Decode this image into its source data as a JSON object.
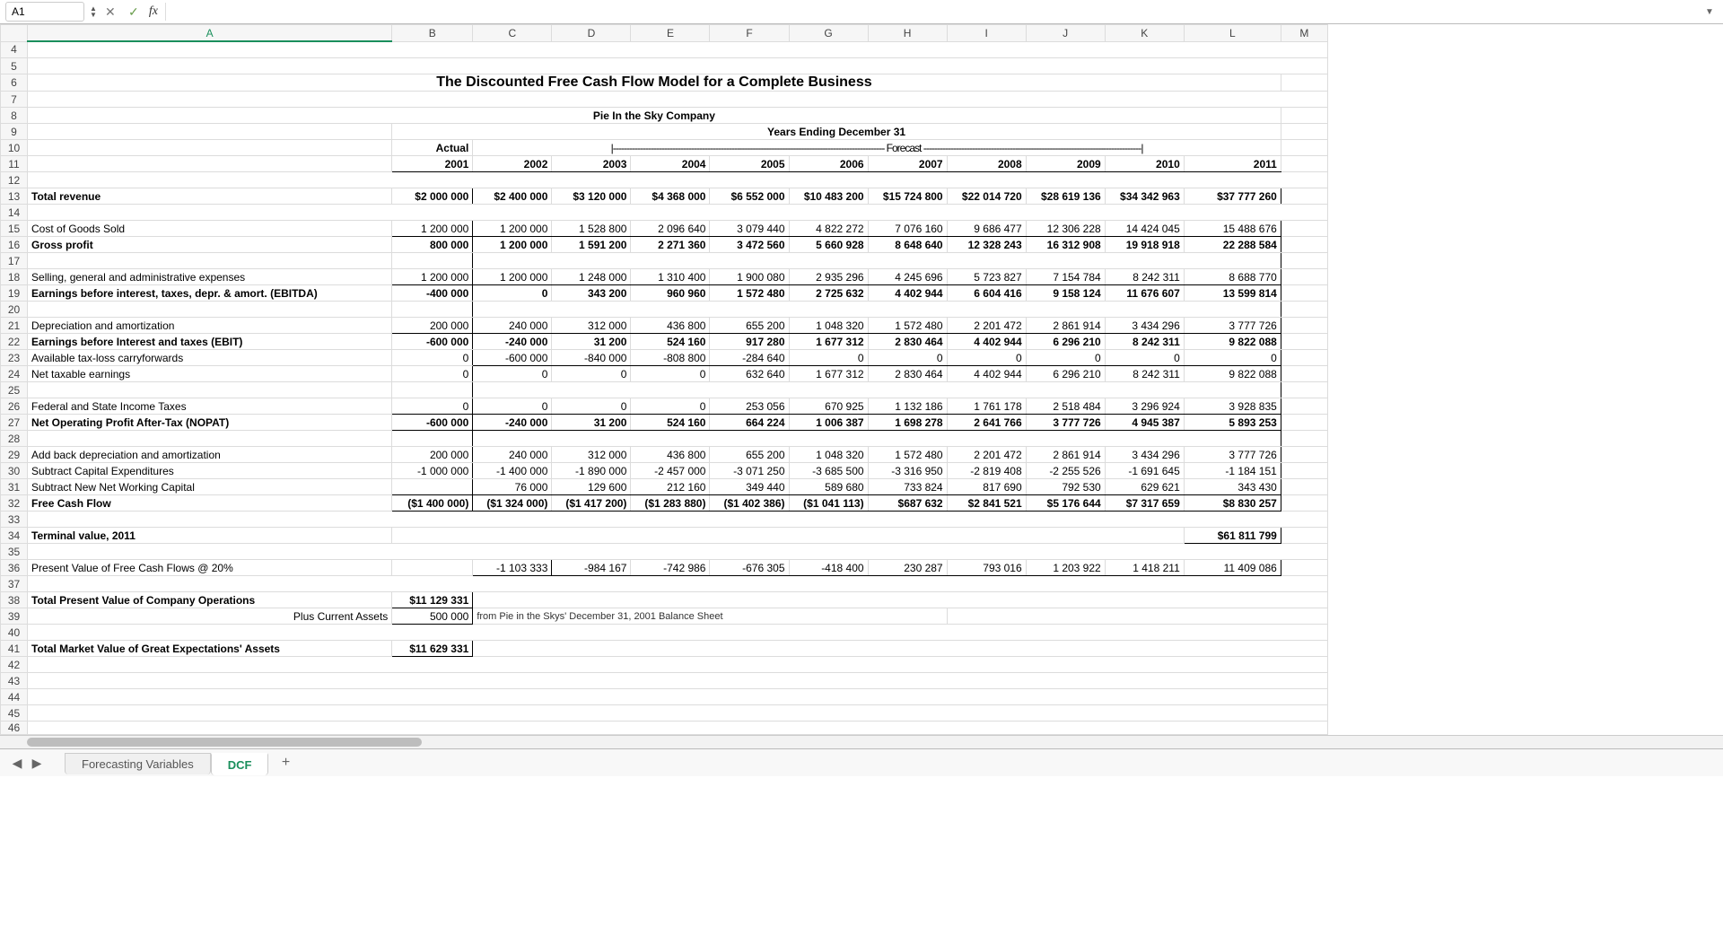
{
  "formula_bar": {
    "cell_ref": "A1",
    "cancel": "✕",
    "accept": "✓",
    "fx": "fx",
    "value": ""
  },
  "columns": [
    "A",
    "B",
    "C",
    "D",
    "E",
    "F",
    "G",
    "H",
    "I",
    "J",
    "K",
    "L",
    "M"
  ],
  "row_numbers": [
    4,
    5,
    6,
    7,
    8,
    9,
    10,
    11,
    12,
    13,
    14,
    15,
    16,
    17,
    18,
    19,
    20,
    21,
    22,
    23,
    24,
    25,
    26,
    27,
    28,
    29,
    30,
    31,
    32,
    33,
    34,
    35,
    36,
    37,
    38,
    39,
    40,
    41,
    42,
    43,
    44,
    45
  ],
  "partial_row": "46",
  "headers": {
    "title": "The Discounted Free Cash Flow Model for a Complete Business",
    "company": "Pie In the Sky Company",
    "years_ending": "Years Ending December 31",
    "actual": "Actual",
    "forecast_line_left": "|----------------------------------------------------------------------------------------------------- Forecast ---------------------------------------------------------------------------------|"
  },
  "years": {
    "b": "2001",
    "c": "2002",
    "d": "2003",
    "e": "2004",
    "f": "2005",
    "g": "2006",
    "h": "2007",
    "i": "2008",
    "j": "2009",
    "k": "2010",
    "l": "2011"
  },
  "labels": {
    "total_revenue": "Total revenue",
    "cogs": "Cost of Goods Sold",
    "gross_profit": "Gross profit",
    "sga": "Selling, general and administrative expenses",
    "ebitda": "Earnings before interest, taxes, depr. & amort. (EBITDA)",
    "da": "Depreciation and amortization",
    "ebit": "Earnings before Interest and taxes (EBIT)",
    "nol": "Available tax-loss carryforwards",
    "net_tax_earn": "Net taxable earnings",
    "taxes": "Federal and State Income Taxes",
    "nopat": "Net Operating Profit After-Tax (NOPAT)",
    "addback_da": "Add back depreciation and amortization",
    "capex": "Subtract Capital Expenditures",
    "nwc": "Subtract New Net Working Capital",
    "fcf": "Free Cash Flow",
    "terminal": "Terminal value, 2011",
    "pv": "Present Value of Free Cash Flows @ 20%",
    "total_pv": "Total Present Value of Company Operations",
    "plus_ca": "Plus Current Assets",
    "note": "from Pie in the Skys' December 31, 2001 Balance Sheet",
    "tmv": "Total Market Value of Great Expectations' Assets"
  },
  "v": {
    "rev": [
      "$2 000 000",
      "$2 400 000",
      "$3 120 000",
      "$4 368 000",
      "$6 552 000",
      "$10 483 200",
      "$15 724 800",
      "$22 014 720",
      "$28 619 136",
      "$34 342 963",
      "$37 777 260"
    ],
    "cogs": [
      "1 200 000",
      "1 200 000",
      "1 528 800",
      "2 096 640",
      "3 079 440",
      "4 822 272",
      "7 076 160",
      "9 686 477",
      "12 306 228",
      "14 424 045",
      "15 488 676"
    ],
    "gp": [
      "800 000",
      "1 200 000",
      "1 591 200",
      "2 271 360",
      "3 472 560",
      "5 660 928",
      "8 648 640",
      "12 328 243",
      "16 312 908",
      "19 918 918",
      "22 288 584"
    ],
    "sga": [
      "1 200 000",
      "1 200 000",
      "1 248 000",
      "1 310 400",
      "1 900 080",
      "2 935 296",
      "4 245 696",
      "5 723 827",
      "7 154 784",
      "8 242 311",
      "8 688 770"
    ],
    "ebitda": [
      "-400 000",
      "0",
      "343 200",
      "960 960",
      "1 572 480",
      "2 725 632",
      "4 402 944",
      "6 604 416",
      "9 158 124",
      "11 676 607",
      "13 599 814"
    ],
    "da": [
      "200 000",
      "240 000",
      "312 000",
      "436 800",
      "655 200",
      "1 048 320",
      "1 572 480",
      "2 201 472",
      "2 861 914",
      "3 434 296",
      "3 777 726"
    ],
    "ebit": [
      "-600 000",
      "-240 000",
      "31 200",
      "524 160",
      "917 280",
      "1 677 312",
      "2 830 464",
      "4 402 944",
      "6 296 210",
      "8 242 311",
      "9 822 088"
    ],
    "nol": [
      "0",
      "-600 000",
      "-840 000",
      "-808 800",
      "-284 640",
      "0",
      "0",
      "0",
      "0",
      "0",
      "0"
    ],
    "nte": [
      "0",
      "0",
      "0",
      "0",
      "632 640",
      "1 677 312",
      "2 830 464",
      "4 402 944",
      "6 296 210",
      "8 242 311",
      "9 822 088"
    ],
    "tax": [
      "0",
      "0",
      "0",
      "0",
      "253 056",
      "670 925",
      "1 132 186",
      "1 761 178",
      "2 518 484",
      "3 296 924",
      "3 928 835"
    ],
    "nopat": [
      "-600 000",
      "-240 000",
      "31 200",
      "524 160",
      "664 224",
      "1 006 387",
      "1 698 278",
      "2 641 766",
      "3 777 726",
      "4 945 387",
      "5 893 253"
    ],
    "addda": [
      "200 000",
      "240 000",
      "312 000",
      "436 800",
      "655 200",
      "1 048 320",
      "1 572 480",
      "2 201 472",
      "2 861 914",
      "3 434 296",
      "3 777 726"
    ],
    "capex": [
      "-1 000 000",
      "-1 400 000",
      "-1 890 000",
      "-2 457 000",
      "-3 071 250",
      "-3 685 500",
      "-3 316 950",
      "-2 819 408",
      "-2 255 526",
      "-1 691 645",
      "-1 184 151"
    ],
    "nwc": [
      "",
      "76 000",
      "129 600",
      "212 160",
      "349 440",
      "589 680",
      "733 824",
      "817 690",
      "792 530",
      "629 621",
      "343 430"
    ],
    "fcf": [
      "($1 400 000)",
      "($1 324 000)",
      "($1 417 200)",
      "($1 283 880)",
      "($1 402 386)",
      "($1 041 113)",
      "$687 632",
      "$2 841 521",
      "$5 176 644",
      "$7 317 659",
      "$8 830 257"
    ],
    "terminal": "$61 811 799",
    "pv": [
      "",
      "-1 103 333",
      "-984 167",
      "-742 986",
      "-676 305",
      "-418 400",
      "230 287",
      "793 016",
      "1 203 922",
      "1 418 211",
      "11 409 086"
    ],
    "total_pv": "$11 129 331",
    "plus_ca": "500 000",
    "tmv": "$11 629 331"
  },
  "tabs": {
    "t1": "Forecasting Variables",
    "t2": "DCF",
    "add": "+"
  }
}
